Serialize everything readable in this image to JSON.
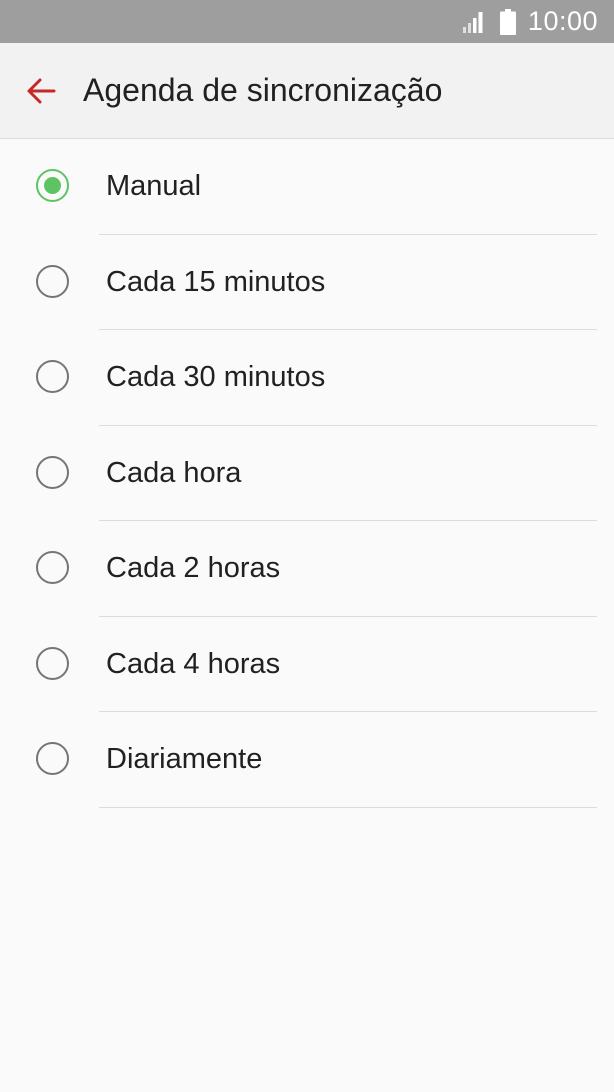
{
  "status_bar": {
    "time": "10:00",
    "signal_icon": "signal-icon",
    "battery_icon": "battery-icon"
  },
  "app_bar": {
    "back_icon": "arrow-back-icon",
    "title": "Agenda de sincronização",
    "accent_color": "#c62828"
  },
  "options": [
    {
      "label": "Manual",
      "selected": true
    },
    {
      "label": "Cada 15 minutos",
      "selected": false
    },
    {
      "label": "Cada 30 minutos",
      "selected": false
    },
    {
      "label": "Cada hora",
      "selected": false
    },
    {
      "label": "Cada 2 horas",
      "selected": false
    },
    {
      "label": "Cada 4 horas",
      "selected": false
    },
    {
      "label": "Diariamente",
      "selected": false
    }
  ],
  "colors": {
    "selected_radio": "#5cc463",
    "unselected_radio": "#757575",
    "status_bar": "#9e9e9e"
  }
}
